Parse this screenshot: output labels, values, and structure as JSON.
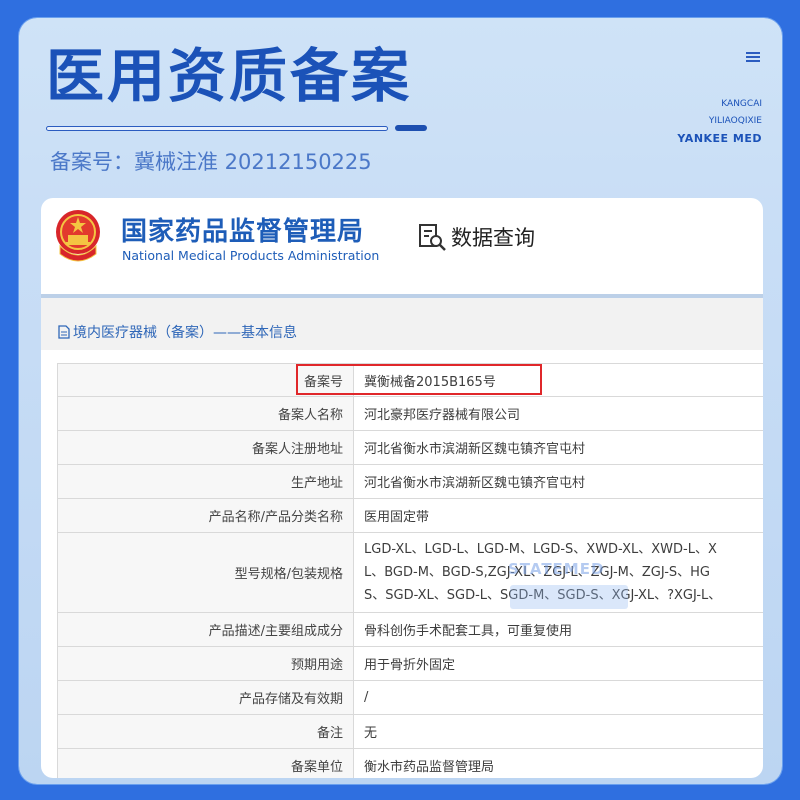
{
  "banner": {
    "title": "医用资质备案",
    "reg_number": "备案号：冀械注准  20212150225",
    "brand_lines": [
      "KANGCAI",
      "YILIAOQIXIE",
      "YANKEE MED"
    ]
  },
  "agency": {
    "name_cn": "国家药品监督管理局",
    "name_en": "National Medical Products Administration",
    "query_label": "数据查询"
  },
  "section": {
    "title": "境内医疗器械（备案）——基本信息"
  },
  "table": {
    "rows": [
      {
        "label": "备案号",
        "value": "冀衡械备2015B165号"
      },
      {
        "label": "备案人名称",
        "value": "河北豪邦医疗器械有限公司"
      },
      {
        "label": "备案人注册地址",
        "value": "河北省衡水市滨湖新区魏屯镇齐官屯村"
      },
      {
        "label": "生产地址",
        "value": "河北省衡水市滨湖新区魏屯镇齐官屯村"
      },
      {
        "label": "产品名称/产品分类名称",
        "value": "医用固定带"
      },
      {
        "label": "型号规格/包装规格",
        "value_lines": [
          "LGD-XL、LGD-L、LGD-M、LGD-S、XWD-XL、XWD-L、X",
          "L、BGD-M、BGD-S,ZGJ-XL、ZGJ-L、ZGJ-M、ZGJ-S、HG",
          "S、SGD-XL、SGD-L、SGD-M、SGD-S、XGJ-XL、?XGJ-L、"
        ]
      },
      {
        "label": "产品描述/主要组成成分",
        "value": "骨科创伤手术配套工具，可重复使用"
      },
      {
        "label": "预期用途",
        "value": "用于骨折外固定"
      },
      {
        "label": "产品存储及有效期",
        "value": "/"
      },
      {
        "label": "备注",
        "value": "无"
      },
      {
        "label": "备案单位",
        "value": "衡水市药品监督管理局"
      }
    ]
  },
  "watermark": {
    "text": "STATEMED"
  },
  "colors": {
    "outer_bg": "#2f6fe0",
    "title_blue": "#1b52b8",
    "agency_blue": "#1e5db8",
    "highlight_red": "#e0272a"
  }
}
